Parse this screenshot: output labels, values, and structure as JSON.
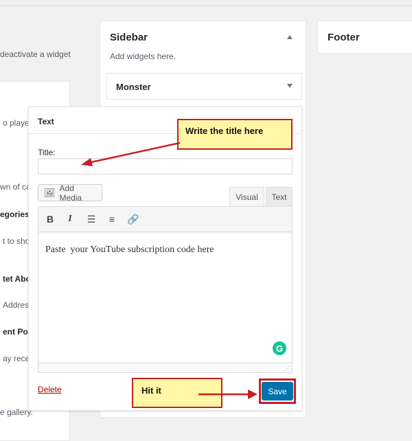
{
  "left": {
    "intro_text": "deactivate a widget",
    "items": [
      "o player.",
      "wn of cat",
      "egories",
      "t to show",
      "tet Abo",
      "Address",
      "ent Post",
      "ay recent",
      "e gallery."
    ]
  },
  "sidebar": {
    "title": "Sidebar",
    "description": "Add widgets here.",
    "widget_monster": "Monster"
  },
  "footer": {
    "title": "Footer"
  },
  "text_widget": {
    "header": "Text",
    "title_label": "Title:",
    "title_value": "",
    "add_media_label": "Add Media",
    "tab_visual": "Visual",
    "tab_text": "Text",
    "content_text": "Paste  your YouTube subscription code here",
    "delete_label": "Delete",
    "save_label": "Save"
  },
  "annotations": {
    "title_callout": "Write the title here",
    "save_callout": "Hit it"
  },
  "colors": {
    "accent": "#0073aa",
    "delete": "#a00",
    "callout_fill": "#fff6a6",
    "callout_border": "#c81d22",
    "grammarly": "#15c39a"
  }
}
